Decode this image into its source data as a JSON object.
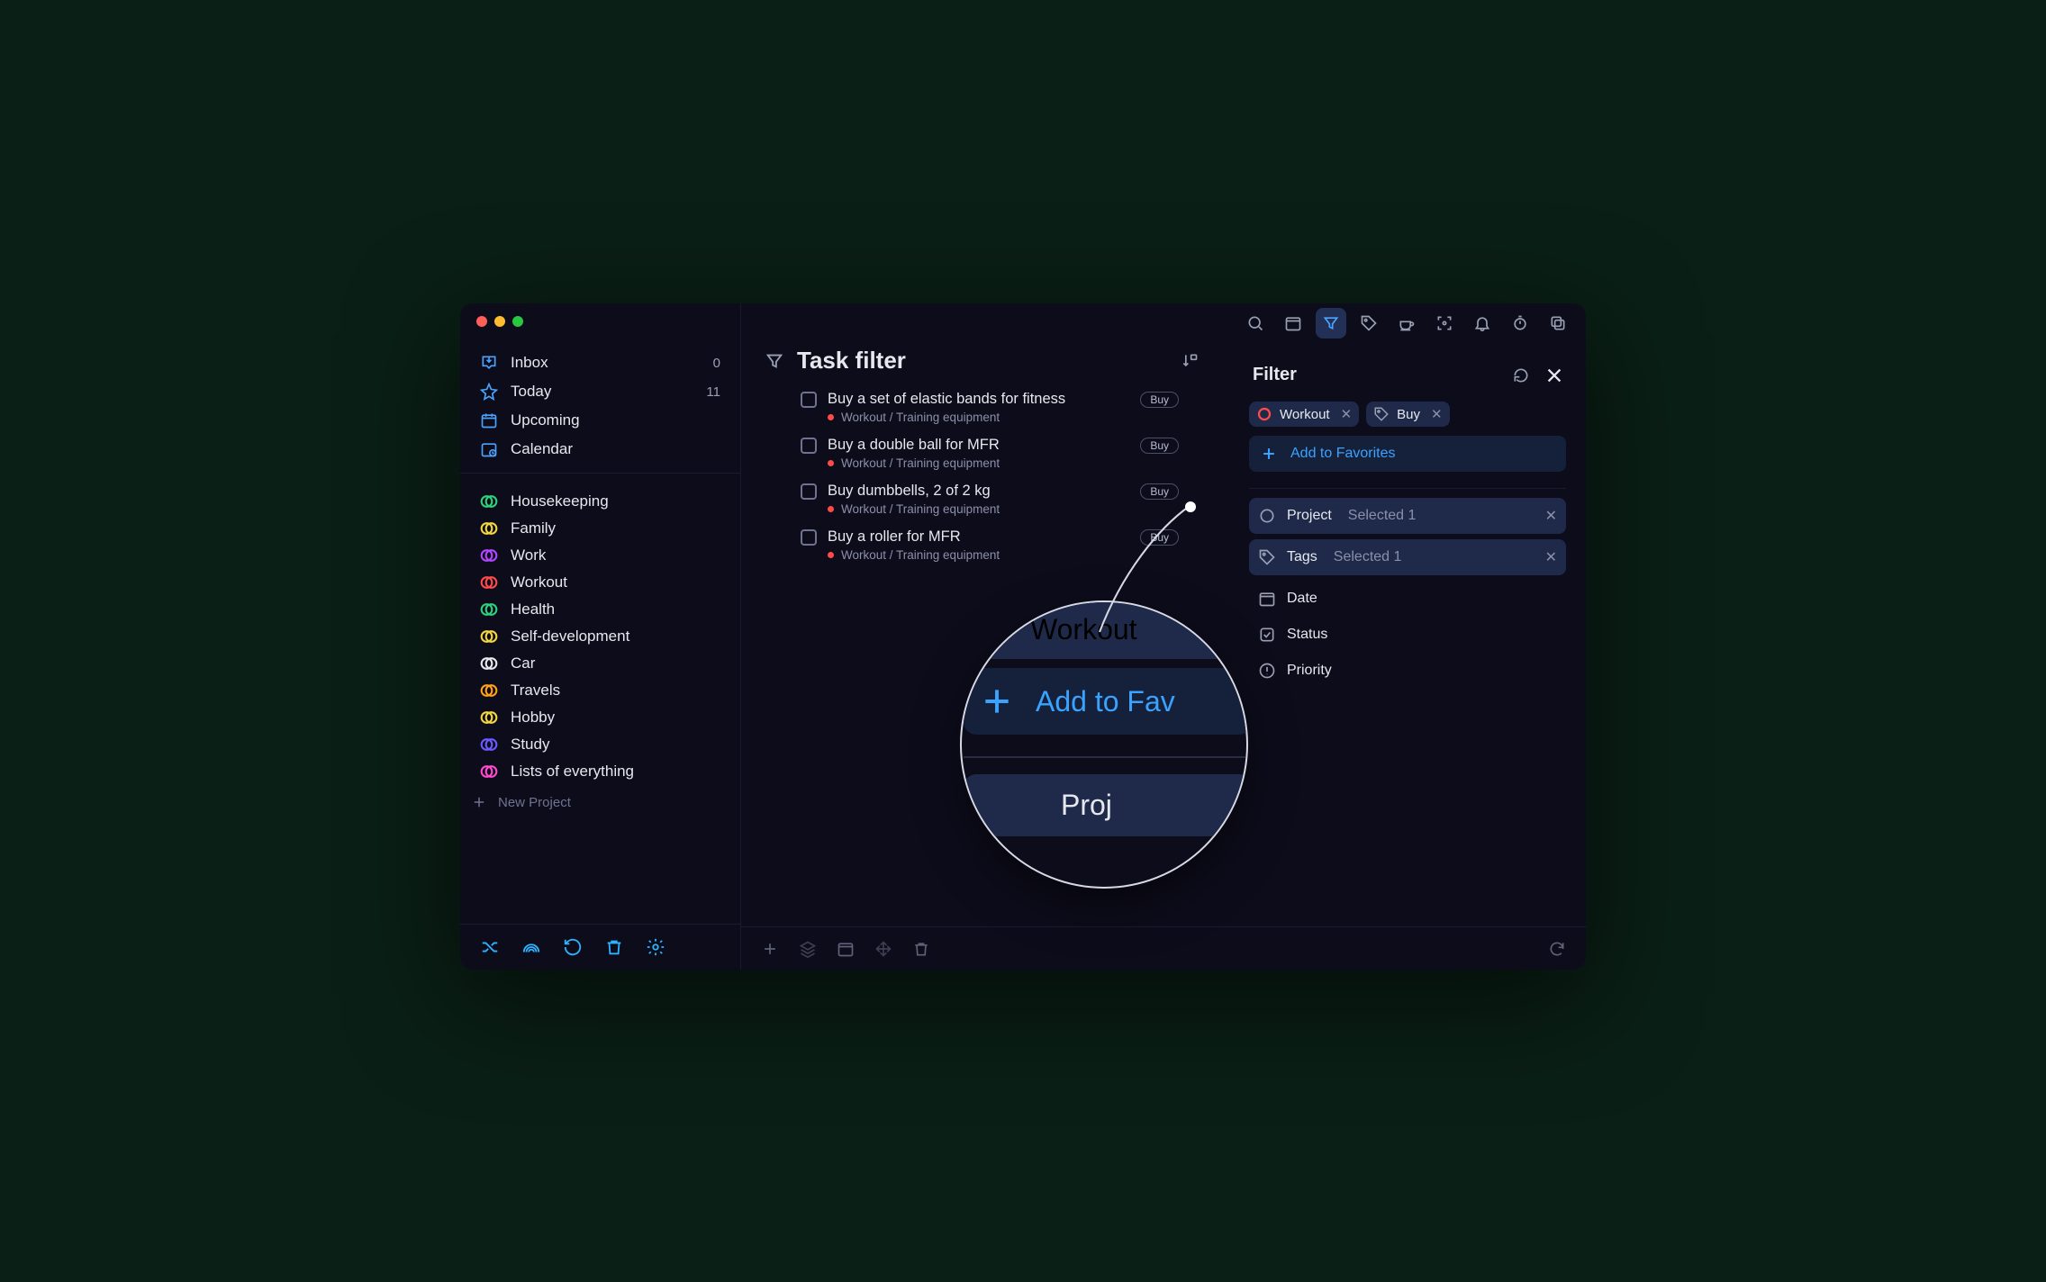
{
  "sidebar": {
    "nav": [
      {
        "id": "inbox",
        "label": "Inbox",
        "count": "0"
      },
      {
        "id": "today",
        "label": "Today",
        "count": "11"
      },
      {
        "id": "upcoming",
        "label": "Upcoming",
        "count": ""
      },
      {
        "id": "calendar",
        "label": "Calendar",
        "count": ""
      }
    ],
    "projects": [
      {
        "label": "Housekeeping",
        "color": "#2fd17b"
      },
      {
        "label": "Family",
        "color": "#f4d641"
      },
      {
        "label": "Work",
        "color": "#b146ff"
      },
      {
        "label": "Workout",
        "color": "#ff4a4a"
      },
      {
        "label": "Health",
        "color": "#2fd17b"
      },
      {
        "label": "Self-development",
        "color": "#f4d641"
      },
      {
        "label": "Car",
        "color": "#e6e8ee"
      },
      {
        "label": "Travels",
        "color": "#ff9f1a"
      },
      {
        "label": "Hobby",
        "color": "#f4d641"
      },
      {
        "label": "Study",
        "color": "#6b5bff"
      },
      {
        "label": "Lists of everything",
        "color": "#ff4ad0"
      }
    ],
    "new_project_label": "New Project"
  },
  "main": {
    "title": "Task filter",
    "task_path": "Workout / Training equipment",
    "tag_label": "Buy",
    "tasks": [
      {
        "title": "Buy a set of elastic bands for fitness"
      },
      {
        "title": "Buy a double ball for MFR"
      },
      {
        "title": "Buy dumbbells, 2 of 2 kg"
      },
      {
        "title": "Buy a roller for MFR"
      }
    ]
  },
  "filter": {
    "title": "Filter",
    "chips": {
      "workout": "Workout",
      "buy": "Buy"
    },
    "add_fav": "Add to Favorites",
    "rows": {
      "project": {
        "label": "Project",
        "selected": "Selected 1"
      },
      "tags": {
        "label": "Tags",
        "selected": "Selected 1"
      },
      "date": "Date",
      "status": "Status",
      "priority": "Priority"
    }
  },
  "magnifier": {
    "workout": "Workout",
    "add_fav": "Add to Fav",
    "project_partial": "Proj"
  }
}
